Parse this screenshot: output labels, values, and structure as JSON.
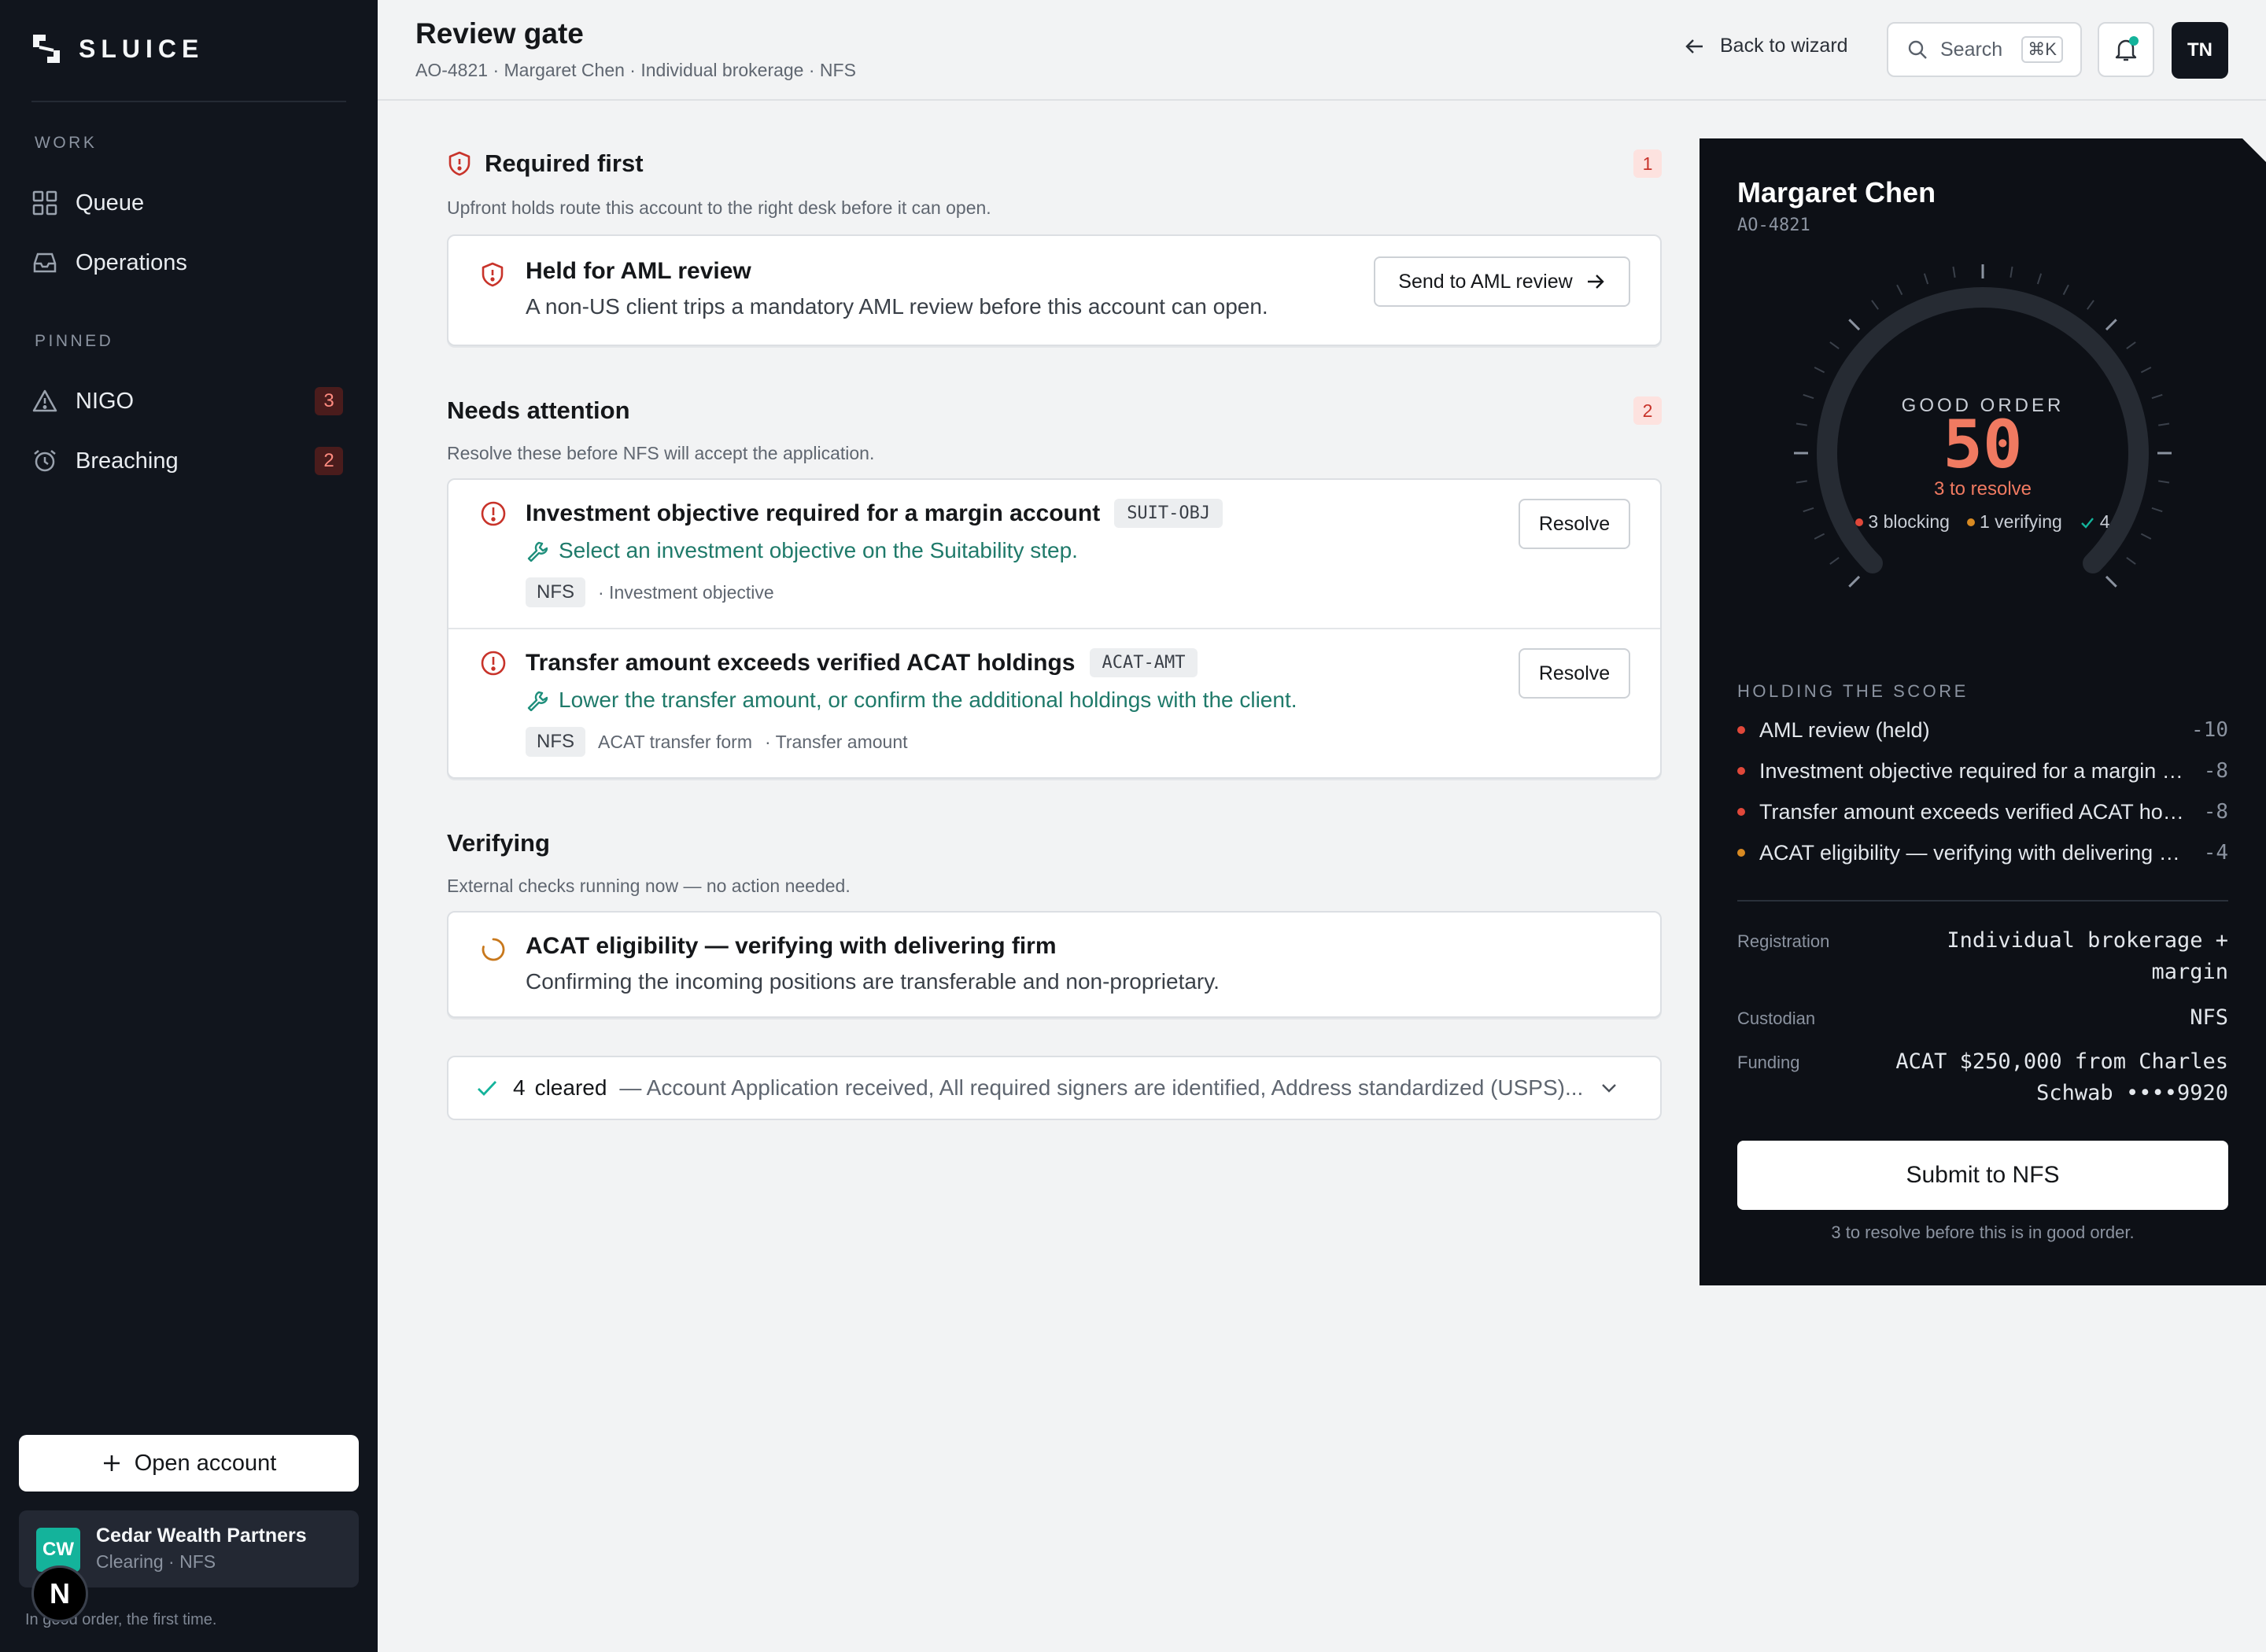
{
  "sidebar": {
    "brand": "SLUICE",
    "sections": {
      "work": "WORK",
      "pinned": "PINNED"
    },
    "work_items": [
      {
        "label": "Queue",
        "icon": "grid-icon"
      },
      {
        "label": "Operations",
        "icon": "inbox-icon"
      }
    ],
    "pinned_items": [
      {
        "label": "NIGO",
        "icon": "warning-icon",
        "count": "3"
      },
      {
        "label": "Breaching",
        "icon": "alarm-clock-icon",
        "count": "2"
      }
    ],
    "open_account_label": "Open account",
    "org": {
      "initials": "CW",
      "name": "Cedar Wealth Partners",
      "subtitle": "Clearing · NFS"
    },
    "bubble_letter": "N",
    "tagline": "In good order, the first time."
  },
  "header": {
    "title": "Review gate",
    "subtitle": "AO-4821 · Margaret Chen · Individual brokerage · NFS",
    "back_label": "Back to wizard",
    "search_label": "Search",
    "search_shortcut": "⌘K",
    "user_initials": "TN"
  },
  "required": {
    "title": "Required first",
    "count": "1",
    "description": "Upfront holds route this account to the right desk before it can open.",
    "item": {
      "title": "Held for AML review",
      "description": "A non-US client trips a mandatory AML review before this account can open.",
      "action_label": "Send to AML review"
    }
  },
  "attention": {
    "title": "Needs attention",
    "count": "2",
    "description": "Resolve these before NFS will accept the application.",
    "items": [
      {
        "title": "Investment objective required for a margin account",
        "code": "SUIT-OBJ",
        "fix": "Select an investment objective on the Suitability step.",
        "tag": "NFS",
        "field": "· Investment objective",
        "action_label": "Resolve"
      },
      {
        "title": "Transfer amount exceeds verified ACAT holdings",
        "code": "ACAT-AMT",
        "fix": "Lower the transfer amount, or confirm the additional holdings with the client.",
        "tag": "NFS",
        "form": "ACAT transfer form",
        "field": "· Transfer amount",
        "action_label": "Resolve"
      }
    ]
  },
  "verifying": {
    "title": "Verifying",
    "description": "External checks running now — no action needed.",
    "item": {
      "title": "ACAT eligibility — verifying with delivering firm",
      "description": "Confirming the incoming positions are transferable and non-proprietary."
    }
  },
  "cleared": {
    "count": "4",
    "label": "cleared",
    "summary": "— Account Application received, All required signers are identified, Address standardized (USPS)..."
  },
  "panel": {
    "name": "Margaret Chen",
    "account_id": "AO-4821",
    "gauge": {
      "label": "GOOD ORDER",
      "score": "50",
      "score_fraction": 0.5,
      "to_resolve": "3 to resolve",
      "blocking": "3 blocking",
      "verifying": "1 verifying",
      "cleared": "4"
    },
    "holding_label": "HOLDING THE SCORE",
    "holding": [
      {
        "text": "AML review (held)",
        "value": "-10",
        "color": "#e0483a"
      },
      {
        "text": "Investment objective required for a margin account",
        "value": "-8",
        "color": "#e0483a"
      },
      {
        "text": "Transfer amount exceeds verified ACAT holdings",
        "value": "-8",
        "color": "#e0483a"
      },
      {
        "text": "ACAT eligibility — verifying with delivering firm",
        "value": "-4",
        "color": "#d88a22"
      }
    ],
    "details": [
      {
        "key": "Registration",
        "value": "Individual brokerage + margin"
      },
      {
        "key": "Custodian",
        "value": "NFS"
      },
      {
        "key": "Funding",
        "value": "ACAT $250,000 from Charles Schwab ••••9920"
      }
    ],
    "submit_label": "Submit to NFS",
    "submit_note": "3 to resolve before this is in good order."
  },
  "colors": {
    "accent_red": "#c8332a",
    "score_coral": "#f07a61",
    "teal": "#14b39b",
    "fix_green": "#1f7a6a",
    "amber": "#d88a22"
  }
}
